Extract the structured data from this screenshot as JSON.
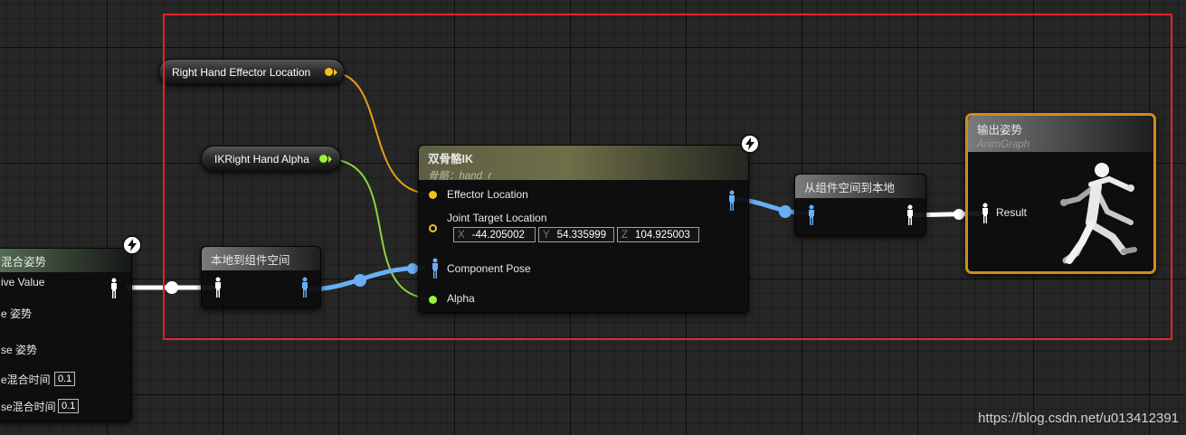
{
  "left_node": {
    "title": "混合姿势",
    "rows": [
      "ive Value",
      "e 姿势",
      "se 姿势",
      "e混合时间",
      "se混合时间"
    ],
    "blend_time_1": "0.1",
    "blend_time_2": "0.1"
  },
  "var_nodes": {
    "right_hand_effector": "Right Hand Effector Location",
    "ik_right_hand_alpha": "IKRight Hand Alpha"
  },
  "local_to_component": {
    "title": "本地到组件空间"
  },
  "two_bone_ik": {
    "title": "双骨骼IK",
    "subtitle": "骨骼：hand_r",
    "pins": {
      "effector_location": "Effector Location",
      "joint_target_location": "Joint Target Location",
      "component_pose": "Component Pose",
      "alpha": "Alpha"
    },
    "joint_target": {
      "x_label": "X",
      "x": "-44.205002",
      "y_label": "Y",
      "y": "54.335999",
      "z_label": "Z",
      "z": "104.925003"
    }
  },
  "component_to_local": {
    "title": "从组件空间到本地"
  },
  "output_pose": {
    "title": "输出姿势",
    "subtitle": "AnimGraph",
    "result_label": "Result"
  },
  "watermark": "https://blog.csdn.net/u013412391",
  "colors": {
    "vector_pin": "#f2c21b",
    "float_pin": "#9cf042",
    "component_pose_wire": "#6aaef4",
    "local_pose_wire": "#ffffff",
    "selection_border": "#e0252a",
    "output_border": "#d48a1e"
  },
  "icons": [
    "lightning-bolt-icon",
    "pose-pin-icon",
    "running-mannequin-icon"
  ]
}
